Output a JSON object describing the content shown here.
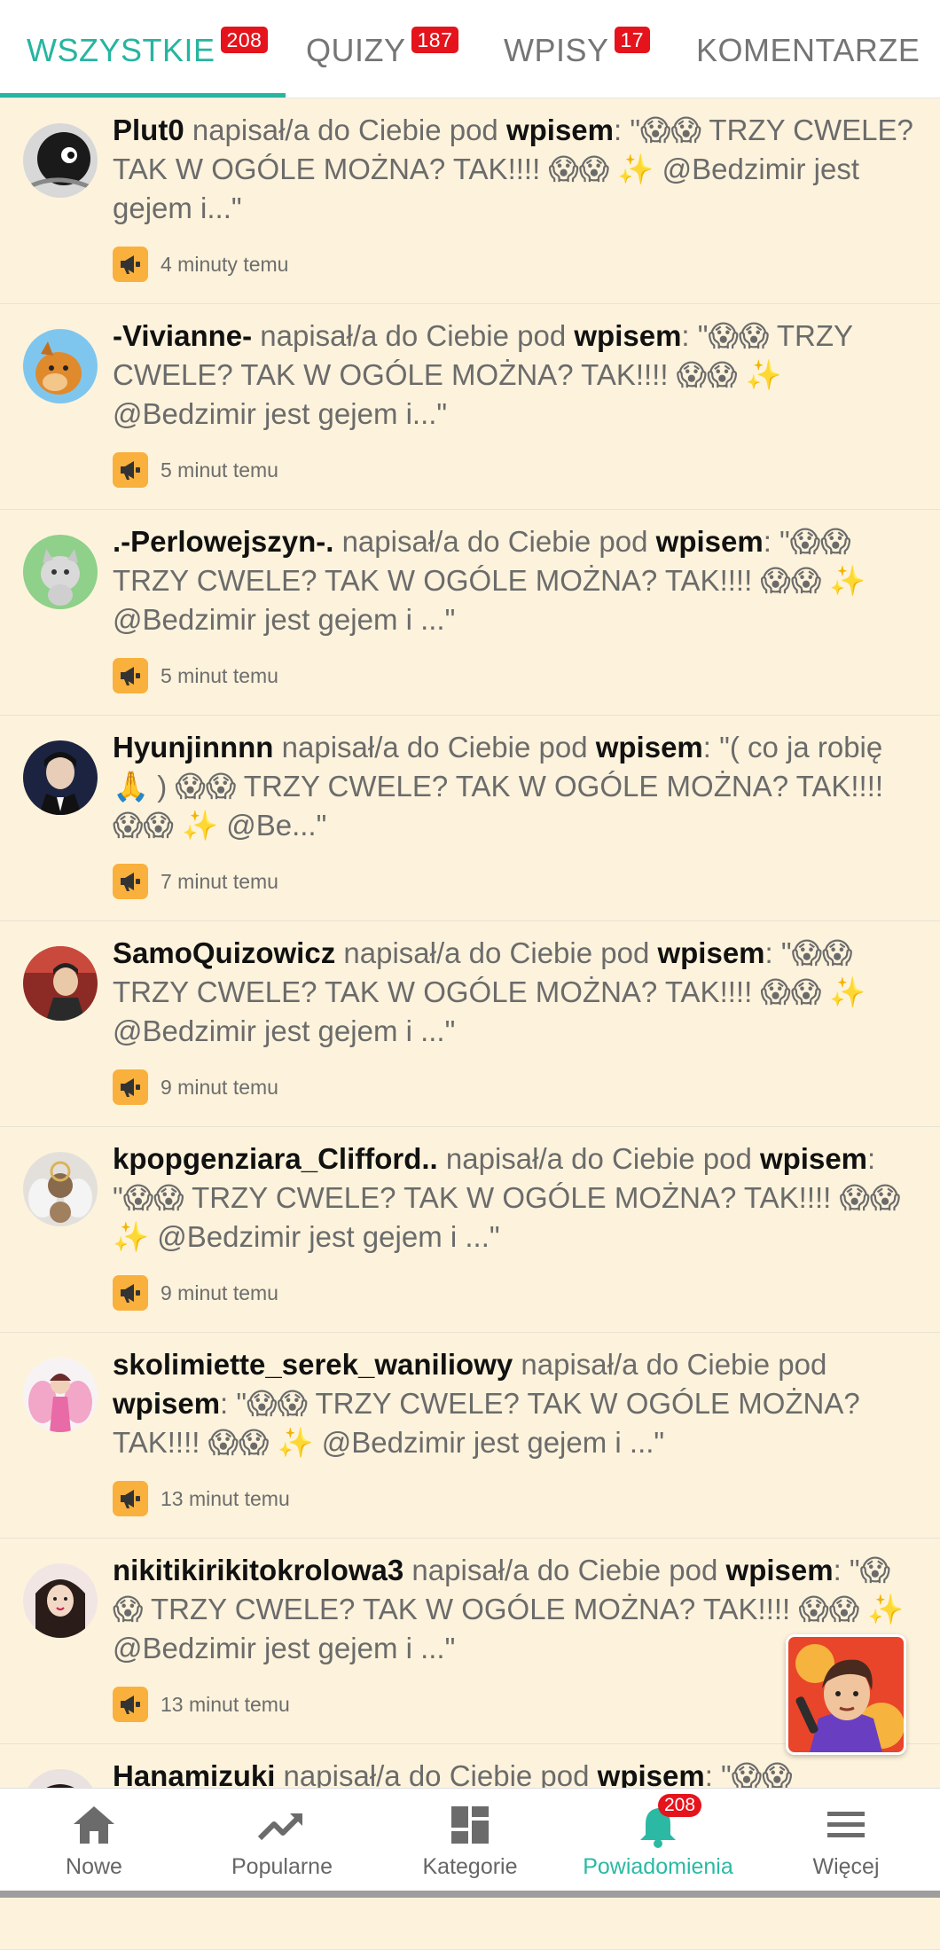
{
  "tabs": [
    {
      "label": "WSZYSTKIE",
      "badge": "208"
    },
    {
      "label": "QUIZY",
      "badge": "187"
    },
    {
      "label": "WPISY",
      "badge": "17"
    },
    {
      "label": "KOMENTARZE"
    }
  ],
  "notifications": [
    {
      "user": "Plut0",
      "text": " napisał/a do Ciebie pod ",
      "target": "wpisem",
      "quote": ": \"😱😱 TRZY CWELE? TAK W OGÓLE MOŻNA? TAK!!!! 😱😱 ✨ @Bedzimir jest gejem i...\"",
      "time": "4 minuty temu"
    },
    {
      "user": "-Vivianne-",
      "text": " napisał/a do Ciebie pod ",
      "target": "wpisem",
      "quote": ": \"😱😱 TRZY CWELE? TAK W OGÓLE MOŻNA? TAK!!!! 😱😱 ✨ @Bedzimir jest gejem i...\"",
      "time": "5 minut temu"
    },
    {
      "user": ".-Perlowejszyn-.",
      "text": " napisał/a do Ciebie pod ",
      "target": "wpisem",
      "quote": ": \"😱😱 TRZY CWELE? TAK W OGÓLE MOŻNA? TAK!!!! 😱😱 ✨ @Bedzimir jest gejem i ...\"",
      "time": "5 minut temu"
    },
    {
      "user": "Hyunjinnnn",
      "text": " napisał/a do Ciebie pod ",
      "target": "wpisem",
      "quote": ": \"( co ja robię 🙏 ) 😱😱 TRZY CWELE? TAK W OGÓLE MOŻNA? TAK!!!! 😱😱 ✨ @Be...\"",
      "time": "7 minut temu"
    },
    {
      "user": "SamoQuizowicz",
      "text": " napisał/a do Ciebie pod ",
      "target": "wpisem",
      "quote": ": \"😱😱 TRZY CWELE? TAK W OGÓLE MOŻNA? TAK!!!! 😱😱 ✨ @Bedzimir jest gejem i ...\"",
      "time": "9 minut temu"
    },
    {
      "user": "kpopgenziara_Clifford..",
      "text": " napisał/a do Ciebie pod ",
      "target": "wpisem",
      "quote": ": \"😱😱 TRZY CWELE? TAK W OGÓLE MOŻNA? TAK!!!! 😱😱 ✨ @Bedzimir jest gejem i ...\"",
      "time": "9 minut temu"
    },
    {
      "user": "skolimiette_serek_waniliowy",
      "text": " napisał/a do Ciebie pod ",
      "target": "wpisem",
      "quote": ": \"😱😱 TRZY CWELE? TAK W OGÓLE MOŻNA? TAK!!!! 😱😱 ✨ @Bedzimir jest gejem i ...\"",
      "time": "13 minut temu"
    },
    {
      "user": "nikitikirikitokrolowa3",
      "text": " napisał/a do Ciebie pod ",
      "target": "wpisem",
      "quote": ": \"😱😱 TRZY CWELE? TAK W OGÓLE MOŻNA? TAK!!!! 😱😱 ✨ @Bedzimir jest gejem i ...\"",
      "time": "13 minut temu"
    },
    {
      "user": "Hanamizuki",
      "text": " napisał/a do Ciebie pod ",
      "target": "wpisem",
      "quote": ": \"😱😱",
      "time": ""
    }
  ],
  "nav": [
    {
      "label": "Nowe",
      "icon": "home-icon"
    },
    {
      "label": "Popularne",
      "icon": "trending-icon"
    },
    {
      "label": "Kategorie",
      "icon": "grid-icon"
    },
    {
      "label": "Powiadomienia",
      "icon": "bell-icon",
      "badge": "208"
    },
    {
      "label": "Więcej",
      "icon": "menu-icon"
    }
  ],
  "colors": {
    "accent": "#26b5a0",
    "badge": "#e5131c",
    "background": "#fdf3dc",
    "megaphone": "#f9b03c"
  }
}
